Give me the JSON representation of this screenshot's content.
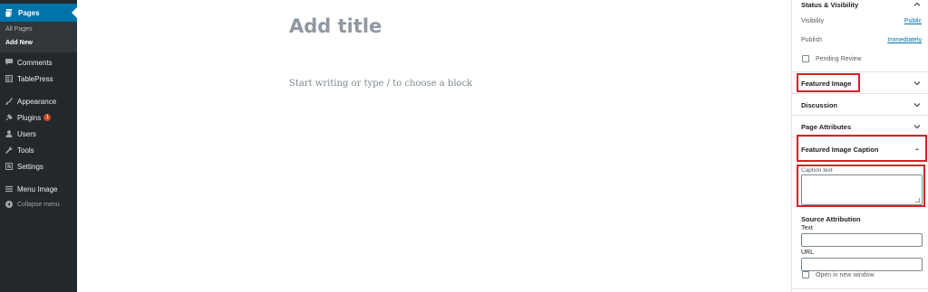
{
  "sidebar": {
    "current": {
      "label": "Pages",
      "icon": "pages-icon"
    },
    "submenu": [
      {
        "label": "All Pages"
      },
      {
        "label": "Add New"
      }
    ],
    "items": [
      {
        "label": "Comments",
        "icon": "comments-icon"
      },
      {
        "label": "TablePress",
        "icon": "table-icon"
      },
      {
        "label": "Appearance",
        "icon": "brush-icon"
      },
      {
        "label": "Plugins",
        "icon": "plugin-icon",
        "badge": "1"
      },
      {
        "label": "Users",
        "icon": "user-icon"
      },
      {
        "label": "Tools",
        "icon": "wrench-icon"
      },
      {
        "label": "Settings",
        "icon": "settings-icon"
      },
      {
        "label": "Menu Image",
        "icon": "menu-icon"
      },
      {
        "label": "Collapse menu",
        "icon": "collapse-icon"
      }
    ]
  },
  "editor": {
    "title_placeholder": "Add title",
    "body_placeholder": "Start writing or type / to choose a block"
  },
  "panel": {
    "status": {
      "title": "Status & Visibility",
      "visibility_label": "Visibility",
      "visibility_value": "Public",
      "publish_label": "Publish",
      "publish_value": "Immediately",
      "pending_label": "Pending Review"
    },
    "featured_image": "Featured Image",
    "discussion": "Discussion",
    "page_attributes": "Page Attributes",
    "caption": {
      "title": "Featured Image Caption",
      "field_label": "Caption text",
      "source_title": "Source Attribution",
      "text_label": "Text",
      "url_label": "URL",
      "new_window_label": "Open in new window"
    }
  },
  "colors": {
    "sidebar_bg": "#23282d",
    "sidebar_active": "#0073aa",
    "highlight_red": "#dc1f26",
    "link": "#0073aa"
  }
}
